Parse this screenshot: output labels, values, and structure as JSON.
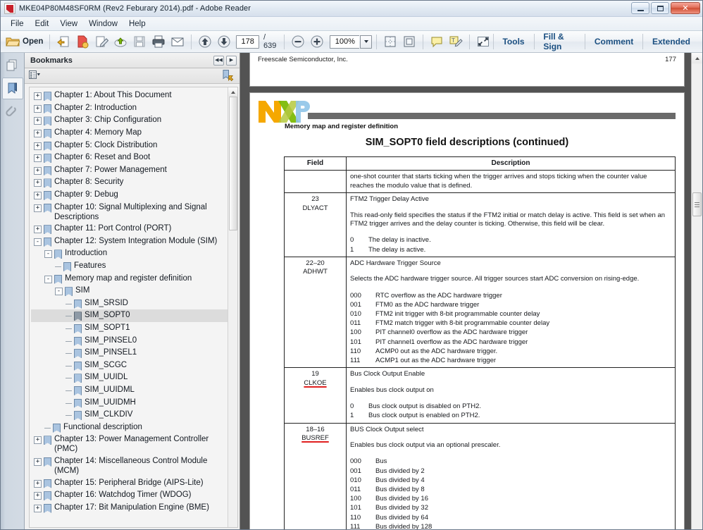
{
  "window": {
    "title": "MKE04P80M48SF0RM (Rev2 Feburary 2014).pdf - Adobe Reader",
    "app_icon": "pdf-icon",
    "minimize": "minimize",
    "maximize": "maximize",
    "close": "close"
  },
  "menubar": {
    "items": [
      "File",
      "Edit",
      "View",
      "Window",
      "Help"
    ]
  },
  "toolbar": {
    "open_label": "Open",
    "page_current": "178",
    "page_total": "/ 639",
    "zoom_value": "100%",
    "icons": [
      "open-folder-icon",
      "save-arrow-icon",
      "export-pdf-icon",
      "edit-pdf-icon",
      "upload-cloud-icon",
      "save-icon",
      "print-icon",
      "email-icon",
      "previous-page-icon",
      "next-page-icon",
      "zoom-out-icon",
      "zoom-in-icon",
      "zoom-dropdown-icon",
      "fit-page-icon",
      "fit-width-icon",
      "sticky-note-icon",
      "highlight-text-icon",
      "read-mode-icon"
    ],
    "right_buttons": [
      "Tools",
      "Fill & Sign",
      "Comment",
      "Extended"
    ]
  },
  "rail": {
    "items": [
      {
        "name": "page-thumbnails-icon",
        "active": false
      },
      {
        "name": "bookmarks-icon",
        "active": true
      },
      {
        "name": "attachments-icon",
        "active": false
      }
    ]
  },
  "bookmarks_panel": {
    "title": "Bookmarks",
    "collapse_label": "◀◀",
    "expand_label": "▶",
    "options_icon": "bookmark-options-icon",
    "new_bookmark_icon": "new-bookmark-icon",
    "tree": [
      {
        "label": "Chapter 1: About This Document",
        "depth": 0,
        "expander": "+"
      },
      {
        "label": "Chapter 2: Introduction",
        "depth": 0,
        "expander": "+"
      },
      {
        "label": "Chapter 3: Chip Configuration",
        "depth": 0,
        "expander": "+"
      },
      {
        "label": "Chapter 4: Memory Map",
        "depth": 0,
        "expander": "+"
      },
      {
        "label": "Chapter 5: Clock Distribution",
        "depth": 0,
        "expander": "+"
      },
      {
        "label": "Chapter 6: Reset and Boot",
        "depth": 0,
        "expander": "+"
      },
      {
        "label": "Chapter 7: Power Management",
        "depth": 0,
        "expander": "+"
      },
      {
        "label": "Chapter 8: Security",
        "depth": 0,
        "expander": "+"
      },
      {
        "label": "Chapter 9: Debug",
        "depth": 0,
        "expander": "+"
      },
      {
        "label": "Chapter 10: Signal Multiplexing and Signal Descriptions",
        "depth": 0,
        "expander": "+"
      },
      {
        "label": "Chapter 11: Port Control (PORT)",
        "depth": 0,
        "expander": "+"
      },
      {
        "label": "Chapter 12: System Integration Module (SIM)",
        "depth": 0,
        "expander": "-"
      },
      {
        "label": "Introduction",
        "depth": 1,
        "expander": "-"
      },
      {
        "label": "Features",
        "depth": 2,
        "expander": ""
      },
      {
        "label": "Memory map and register definition",
        "depth": 1,
        "expander": "-"
      },
      {
        "label": "SIM",
        "depth": 2,
        "expander": "-"
      },
      {
        "label": "SIM_SRSID",
        "depth": 3,
        "expander": ""
      },
      {
        "label": "SIM_SOPT0",
        "depth": 3,
        "expander": "",
        "selected": true
      },
      {
        "label": "SIM_SOPT1",
        "depth": 3,
        "expander": ""
      },
      {
        "label": "SIM_PINSEL0",
        "depth": 3,
        "expander": ""
      },
      {
        "label": "SIM_PINSEL1",
        "depth": 3,
        "expander": ""
      },
      {
        "label": "SIM_SCGC",
        "depth": 3,
        "expander": ""
      },
      {
        "label": "SIM_UUIDL",
        "depth": 3,
        "expander": ""
      },
      {
        "label": "SIM_UUIDML",
        "depth": 3,
        "expander": ""
      },
      {
        "label": "SIM_UUIDMH",
        "depth": 3,
        "expander": ""
      },
      {
        "label": "SIM_CLKDIV",
        "depth": 3,
        "expander": ""
      },
      {
        "label": "Functional description",
        "depth": 1,
        "expander": ""
      },
      {
        "label": "Chapter 13: Power Management Controller (PMC)",
        "depth": 0,
        "expander": "+"
      },
      {
        "label": "Chapter 14: Miscellaneous Control Module (MCM)",
        "depth": 0,
        "expander": "+"
      },
      {
        "label": "Chapter 15: Peripheral Bridge (AIPS-Lite)",
        "depth": 0,
        "expander": "+"
      },
      {
        "label": "Chapter 16: Watchdog Timer (WDOG)",
        "depth": 0,
        "expander": "+"
      },
      {
        "label": "Chapter 17: Bit Manipulation Engine (BME)",
        "depth": 0,
        "expander": "+"
      }
    ]
  },
  "document": {
    "previous_page_footer": {
      "left": "Freescale Semiconductor, Inc.",
      "right": "177"
    },
    "logo": "nxp-logo",
    "running_head": "Memory map and register definition",
    "table_title": "SIM_SOPT0 field descriptions (continued)",
    "columns": [
      "Field",
      "Description"
    ],
    "rows": [
      {
        "field_bits": "",
        "field_name": "",
        "underline": false,
        "para": "one-shot counter that starts ticking when the trigger arrives and stops ticking when the counter value reaches the modulo value that is defined.",
        "para2": "",
        "options": []
      },
      {
        "field_bits": "23",
        "field_name": "DLYACT",
        "underline": false,
        "para": "FTM2 Trigger Delay Active",
        "para2": "This read-only field specifies the status if the FTM2 initial or match delay is active. This field is set when an FTM2 trigger arrives and the delay counter is ticking. Otherwise, this field will be clear.",
        "options": [
          {
            "code": "0",
            "text": "The delay is inactive."
          },
          {
            "code": "1",
            "text": "The delay is active."
          }
        ]
      },
      {
        "field_bits": "22–20",
        "field_name": "ADHWT",
        "underline": false,
        "para": "ADC Hardware Trigger Source",
        "para2": "Selects the ADC hardware trigger source. All trigger sources start ADC conversion on rising-edge.",
        "options": [
          {
            "code": "000",
            "text": "RTC overflow as the ADC hardware trigger"
          },
          {
            "code": "001",
            "text": "FTM0 as the ADC hardware trigger"
          },
          {
            "code": "010",
            "text": "FTM2 init trigger with 8-bit programmable counter delay"
          },
          {
            "code": "011",
            "text": "FTM2 match trigger with 8-bit programmable counter delay"
          },
          {
            "code": "100",
            "text": "PIT channel0 overflow as the ADC hardware trigger"
          },
          {
            "code": "101",
            "text": "PIT channel1 overflow as the ADC hardware trigger"
          },
          {
            "code": "110",
            "text": "ACMP0 out as the ADC hardware trigger."
          },
          {
            "code": "111",
            "text": "ACMP1 out as the ADC hardware trigger"
          }
        ]
      },
      {
        "field_bits": "19",
        "field_name": "CLKOE",
        "underline": true,
        "para": "Bus Clock Output Enable",
        "para2": "Enables bus clock output on",
        "options": [
          {
            "code": "0",
            "text": "Bus clock output is disabled on PTH2."
          },
          {
            "code": "1",
            "text": "Bus clock output is enabled on PTH2."
          }
        ]
      },
      {
        "field_bits": "18–16",
        "field_name": "BUSREF",
        "underline": true,
        "para": "BUS Clock Output select",
        "para2": "Enables bus clock output via an optional prescaler.",
        "options": [
          {
            "code": "000",
            "text": "Bus"
          },
          {
            "code": "001",
            "text": "Bus divided by 2"
          },
          {
            "code": "010",
            "text": "Bus divided by 4"
          },
          {
            "code": "011",
            "text": "Bus divided by 8"
          },
          {
            "code": "100",
            "text": "Bus divided by 16"
          },
          {
            "code": "101",
            "text": "Bus divided by 32"
          },
          {
            "code": "110",
            "text": "Bus divided by 64"
          },
          {
            "code": "111",
            "text": "Bus divided by 128"
          }
        ]
      }
    ]
  },
  "colors": {
    "annotation_red": "#e02020",
    "nxp_orange": "#f5a800",
    "nxp_green": "#7ab800",
    "nxp_blue": "#7fb2d9",
    "accent_blue": "#1b4f81",
    "selection_gray": "#dcdcdc"
  }
}
